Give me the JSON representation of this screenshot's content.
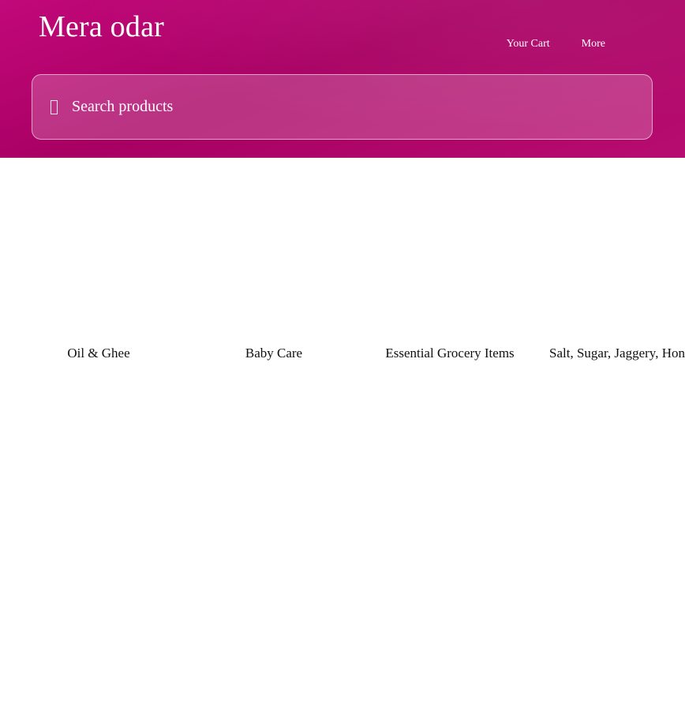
{
  "header": {
    "brand": "Mera odar",
    "nav": {
      "cart_label": "Your Cart",
      "more_label": "More"
    },
    "search": {
      "placeholder": "Search products",
      "icon": "search-icon"
    },
    "colors": {
      "brand_gradient_start": "#c2087a",
      "brand_gradient_mid": "#a80063",
      "brand_gradient_end": "#b70c70"
    }
  },
  "categories": [
    {
      "label": "Oil & Ghee"
    },
    {
      "label": "Baby Care"
    },
    {
      "label": "Essential Grocery Items"
    },
    {
      "label": "Salt, Sugar, Jaggery, Honey"
    }
  ]
}
